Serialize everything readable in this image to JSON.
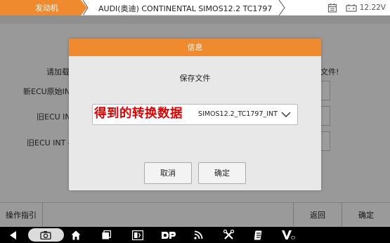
{
  "topbar": {
    "active_tab": "发动机",
    "breadcrumb": "AUDI(奥迪) CONTINENTAL SIMOS12.2 TC1797",
    "voltage": "12.22V",
    "icons": [
      "calendar-icon",
      "battery-icon"
    ]
  },
  "background": {
    "left_label_1": "请加载",
    "right_label_1": "文件!",
    "row_1_label": "新ECU原始IN",
    "row_2_label": "旧ECU IN",
    "row_3_label": "旧ECU INT e"
  },
  "dialog": {
    "header": "信息",
    "title": "保存文件",
    "select_value": "SIMOS12.2_TC1797_INT",
    "overlay_text": "得到的转换数据",
    "cancel_label": "取消",
    "ok_label": "确定"
  },
  "actionbar": {
    "guide_label": "操作指引",
    "back_label": "返回",
    "confirm_label": "确定"
  },
  "navbar": {
    "items": [
      "back-icon",
      "camera-icon",
      "home-icon",
      "recents-icon",
      "vci-screen-icon",
      "dp-icon",
      "wifi-icon",
      "tools-icon",
      "ecu-icon",
      "vci-icon"
    ]
  },
  "colors": {
    "accent": "#f08a2e",
    "overlay_text": "#e10000"
  }
}
